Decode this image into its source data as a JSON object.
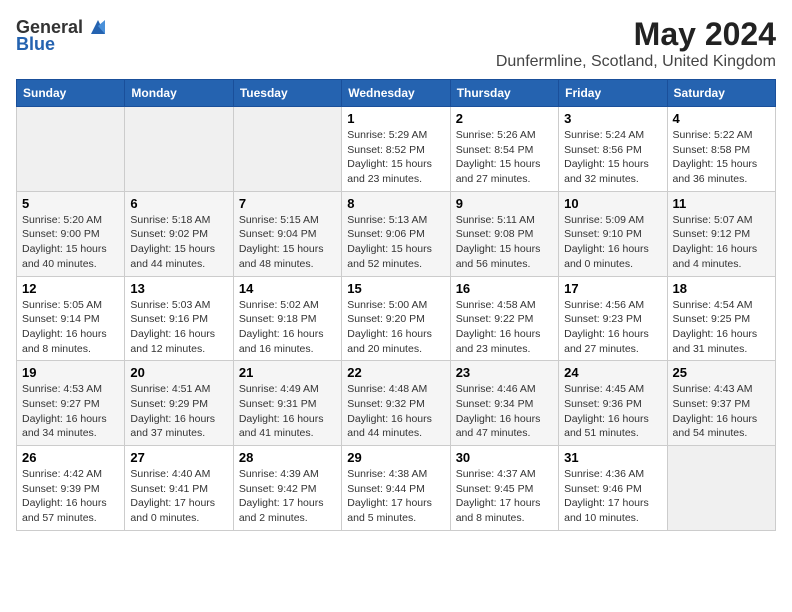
{
  "logo": {
    "general": "General",
    "blue": "Blue"
  },
  "header": {
    "month_year": "May 2024",
    "location": "Dunfermline, Scotland, United Kingdom"
  },
  "weekdays": [
    "Sunday",
    "Monday",
    "Tuesday",
    "Wednesday",
    "Thursday",
    "Friday",
    "Saturday"
  ],
  "weeks": [
    [
      {
        "day": null,
        "content": null
      },
      {
        "day": null,
        "content": null
      },
      {
        "day": null,
        "content": null
      },
      {
        "day": "1",
        "content": "Sunrise: 5:29 AM\nSunset: 8:52 PM\nDaylight: 15 hours\nand 23 minutes."
      },
      {
        "day": "2",
        "content": "Sunrise: 5:26 AM\nSunset: 8:54 PM\nDaylight: 15 hours\nand 27 minutes."
      },
      {
        "day": "3",
        "content": "Sunrise: 5:24 AM\nSunset: 8:56 PM\nDaylight: 15 hours\nand 32 minutes."
      },
      {
        "day": "4",
        "content": "Sunrise: 5:22 AM\nSunset: 8:58 PM\nDaylight: 15 hours\nand 36 minutes."
      }
    ],
    [
      {
        "day": "5",
        "content": "Sunrise: 5:20 AM\nSunset: 9:00 PM\nDaylight: 15 hours\nand 40 minutes."
      },
      {
        "day": "6",
        "content": "Sunrise: 5:18 AM\nSunset: 9:02 PM\nDaylight: 15 hours\nand 44 minutes."
      },
      {
        "day": "7",
        "content": "Sunrise: 5:15 AM\nSunset: 9:04 PM\nDaylight: 15 hours\nand 48 minutes."
      },
      {
        "day": "8",
        "content": "Sunrise: 5:13 AM\nSunset: 9:06 PM\nDaylight: 15 hours\nand 52 minutes."
      },
      {
        "day": "9",
        "content": "Sunrise: 5:11 AM\nSunset: 9:08 PM\nDaylight: 15 hours\nand 56 minutes."
      },
      {
        "day": "10",
        "content": "Sunrise: 5:09 AM\nSunset: 9:10 PM\nDaylight: 16 hours\nand 0 minutes."
      },
      {
        "day": "11",
        "content": "Sunrise: 5:07 AM\nSunset: 9:12 PM\nDaylight: 16 hours\nand 4 minutes."
      }
    ],
    [
      {
        "day": "12",
        "content": "Sunrise: 5:05 AM\nSunset: 9:14 PM\nDaylight: 16 hours\nand 8 minutes."
      },
      {
        "day": "13",
        "content": "Sunrise: 5:03 AM\nSunset: 9:16 PM\nDaylight: 16 hours\nand 12 minutes."
      },
      {
        "day": "14",
        "content": "Sunrise: 5:02 AM\nSunset: 9:18 PM\nDaylight: 16 hours\nand 16 minutes."
      },
      {
        "day": "15",
        "content": "Sunrise: 5:00 AM\nSunset: 9:20 PM\nDaylight: 16 hours\nand 20 minutes."
      },
      {
        "day": "16",
        "content": "Sunrise: 4:58 AM\nSunset: 9:22 PM\nDaylight: 16 hours\nand 23 minutes."
      },
      {
        "day": "17",
        "content": "Sunrise: 4:56 AM\nSunset: 9:23 PM\nDaylight: 16 hours\nand 27 minutes."
      },
      {
        "day": "18",
        "content": "Sunrise: 4:54 AM\nSunset: 9:25 PM\nDaylight: 16 hours\nand 31 minutes."
      }
    ],
    [
      {
        "day": "19",
        "content": "Sunrise: 4:53 AM\nSunset: 9:27 PM\nDaylight: 16 hours\nand 34 minutes."
      },
      {
        "day": "20",
        "content": "Sunrise: 4:51 AM\nSunset: 9:29 PM\nDaylight: 16 hours\nand 37 minutes."
      },
      {
        "day": "21",
        "content": "Sunrise: 4:49 AM\nSunset: 9:31 PM\nDaylight: 16 hours\nand 41 minutes."
      },
      {
        "day": "22",
        "content": "Sunrise: 4:48 AM\nSunset: 9:32 PM\nDaylight: 16 hours\nand 44 minutes."
      },
      {
        "day": "23",
        "content": "Sunrise: 4:46 AM\nSunset: 9:34 PM\nDaylight: 16 hours\nand 47 minutes."
      },
      {
        "day": "24",
        "content": "Sunrise: 4:45 AM\nSunset: 9:36 PM\nDaylight: 16 hours\nand 51 minutes."
      },
      {
        "day": "25",
        "content": "Sunrise: 4:43 AM\nSunset: 9:37 PM\nDaylight: 16 hours\nand 54 minutes."
      }
    ],
    [
      {
        "day": "26",
        "content": "Sunrise: 4:42 AM\nSunset: 9:39 PM\nDaylight: 16 hours\nand 57 minutes."
      },
      {
        "day": "27",
        "content": "Sunrise: 4:40 AM\nSunset: 9:41 PM\nDaylight: 17 hours\nand 0 minutes."
      },
      {
        "day": "28",
        "content": "Sunrise: 4:39 AM\nSunset: 9:42 PM\nDaylight: 17 hours\nand 2 minutes."
      },
      {
        "day": "29",
        "content": "Sunrise: 4:38 AM\nSunset: 9:44 PM\nDaylight: 17 hours\nand 5 minutes."
      },
      {
        "day": "30",
        "content": "Sunrise: 4:37 AM\nSunset: 9:45 PM\nDaylight: 17 hours\nand 8 minutes."
      },
      {
        "day": "31",
        "content": "Sunrise: 4:36 AM\nSunset: 9:46 PM\nDaylight: 17 hours\nand 10 minutes."
      },
      {
        "day": null,
        "content": null
      }
    ]
  ]
}
